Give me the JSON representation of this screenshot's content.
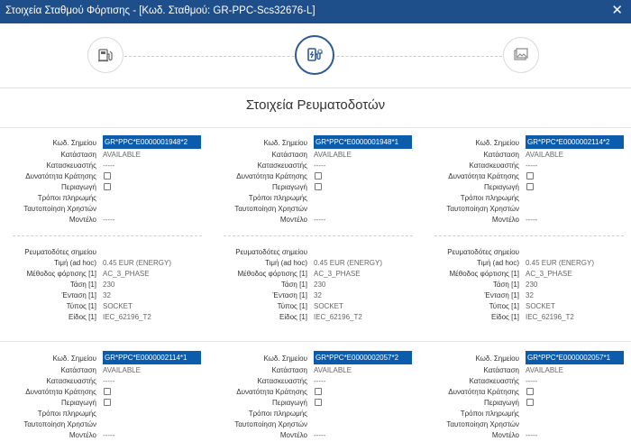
{
  "window": {
    "title": "Στοιχεία Σταθμού Φόρτισης - [Κωδ. Σταθμού: GR-PPC-Scs32676-L]",
    "close": "✕"
  },
  "wizard": {
    "steps": [
      {
        "name": "station-details-step",
        "icon": "charging-station-icon"
      },
      {
        "name": "connectors-step",
        "icon": "ev-plug-icon",
        "active": true
      },
      {
        "name": "photos-step",
        "icon": "image-icon"
      }
    ]
  },
  "section_title": "Στοιχεία Ρευματοδοτών",
  "labels": {
    "point_code": "Κωδ. Σημείου",
    "status": "Κατάσταση",
    "manufacturer": "Κατασκευαστής",
    "booking": "Δυνατότητα Κράτησης",
    "roaming": "Περιαγωγή",
    "payment": "Τρόποι πληρωμής",
    "auth": "Ταυτοποίηση Χρηστών",
    "model": "Μοντέλο",
    "connectors": "Ρευματοδότες σημείου",
    "price": "Τιμή (ad hoc)",
    "charge_method": "Μέθοδος φόρτισης [1]",
    "voltage": "Τάση [1]",
    "current": "Ένταση [1]",
    "type": "Τύπος [1]",
    "kind": "Είδος [1]"
  },
  "points": [
    {
      "code": "GR*PPC*E0000001948*2",
      "status": "AVAILABLE",
      "manufacturer": "-----",
      "model": "-----",
      "price": "0.45  EUR (ENERGY)",
      "charge_method": "AC_3_PHASE",
      "voltage": "230",
      "current": "32",
      "type": "SOCKET",
      "kind": "IEC_62196_T2"
    },
    {
      "code": "GR*PPC*E0000001948*1",
      "status": "AVAILABLE",
      "manufacturer": "-----",
      "model": "-----",
      "price": "0.45  EUR (ENERGY)",
      "charge_method": "AC_3_PHASE",
      "voltage": "230",
      "current": "32",
      "type": "SOCKET",
      "kind": "IEC_62196_T2"
    },
    {
      "code": "GR*PPC*E0000002114*2",
      "status": "AVAILABLE",
      "manufacturer": "-----",
      "model": "-----",
      "price": "0.45  EUR (ENERGY)",
      "charge_method": "AC_3_PHASE",
      "voltage": "230",
      "current": "32",
      "type": "SOCKET",
      "kind": "IEC_62196_T2"
    },
    {
      "code": "GR*PPC*E0000002114*1",
      "status": "AVAILABLE",
      "manufacturer": "-----",
      "model": "-----"
    },
    {
      "code": "GR*PPC*E0000002057*2",
      "status": "AVAILABLE",
      "manufacturer": "-----",
      "model": "-----"
    },
    {
      "code": "GR*PPC*E0000002057*1",
      "status": "AVAILABLE",
      "manufacturer": "-----",
      "model": "-----"
    }
  ]
}
